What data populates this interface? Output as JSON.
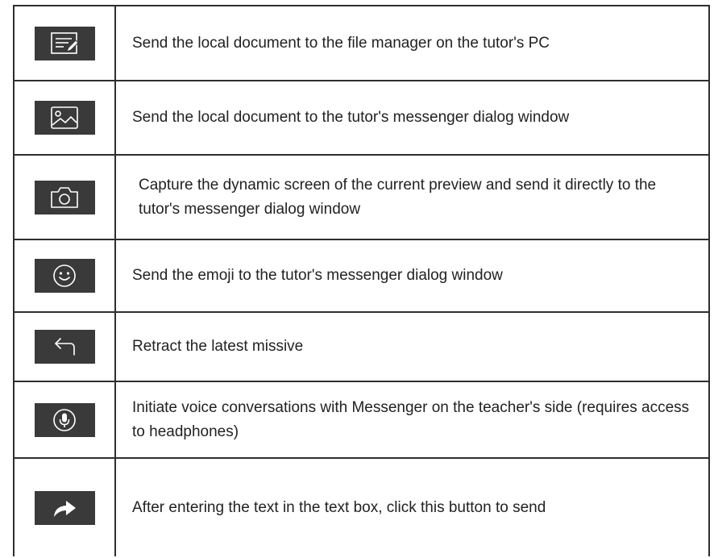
{
  "rows": [
    {
      "icon": "document-edit-icon",
      "description": "Send the local document to the file manager on the tutor's PC"
    },
    {
      "icon": "image-icon",
      "description": "Send the local document to the tutor's messenger dialog window"
    },
    {
      "icon": "camera-icon",
      "description": "Capture the dynamic screen of the current preview and send it directly to the tutor's messenger dialog window"
    },
    {
      "icon": "smiley-icon",
      "description": "Send the emoji to the tutor's messenger dialog window"
    },
    {
      "icon": "undo-arrow-icon",
      "description": "Retract the latest missive"
    },
    {
      "icon": "microphone-icon",
      "description": "Initiate voice conversations with Messenger on the teacher's side (requires access to headphones)"
    },
    {
      "icon": "send-arrow-icon",
      "description": "After entering the text in the text box, click this button to send"
    }
  ],
  "colors": {
    "icon_background": "#3a3a3a",
    "icon_stroke": "#ffffff",
    "border": "#2e2e2e",
    "text": "#222222"
  }
}
